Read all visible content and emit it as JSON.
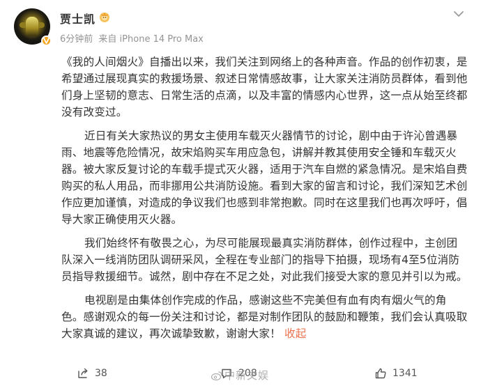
{
  "author": {
    "name": "贾士凯",
    "time": "6分钟前",
    "source": "来自 iPhone 14 Pro Max"
  },
  "post": {
    "paragraphs": [
      "《我的人间烟火》自播出以来，我们关注到网络上的各种声音。作品的创作初衷，是希望通过展现真实的救援场景、叙述日常情感故事，让大家关注消防员群体，看到他们身上坚韧的意志、日常生活的点滴，以及丰富的情感内心世界，这一点从始至终都没有改变过。",
      "近日有关大家热议的男女主使用车载灭火器情节的讨论，剧中由于许沁曾遇暴雨、地震等危险情况，故宋焰购买车用应急包，讲解并教其使用安全锤和车载灭火器。被大家反复讨论的车载手提式灭火器，适用于汽车自燃的紧急情况。是宋焰自费购买的私人用品，而非挪用公共消防设施。看到大家的留言和讨论，我们深知艺术创作应更加谨慎，对造成的争议我们也感到非常抱歉。同时在这里我们也再次呼吁，倡导大家正确使用灭火器。",
      "我们始终怀有敬畏之心，为尽可能展现最真实消防群体，创作过程中，主创团队深入一线消防团队调研采风，全程在专业部门的指导下拍摄，现场有4至5位消防员指导救援细节。诚然，剧中存在不足之处，对此我们接受大家的意见并引以为戒。",
      "电视剧是由集体创作完成的作品，感谢这些不完美但有血有肉有烟火气的角色。感谢观众的每一份关注和讨论，都是对制作团队的鼓励和鞭策，我们会认真吸取大家真诚的建议，再次诚挚致歉，谢谢大家！"
    ],
    "collapse_label": "收起"
  },
  "actions": {
    "share_count": "38",
    "comment_count": "208",
    "like_count": "1341"
  },
  "watermark": "中新文娱",
  "colors": {
    "link": "#eb7350",
    "verify": "#f5a623",
    "meta": "#939393"
  }
}
